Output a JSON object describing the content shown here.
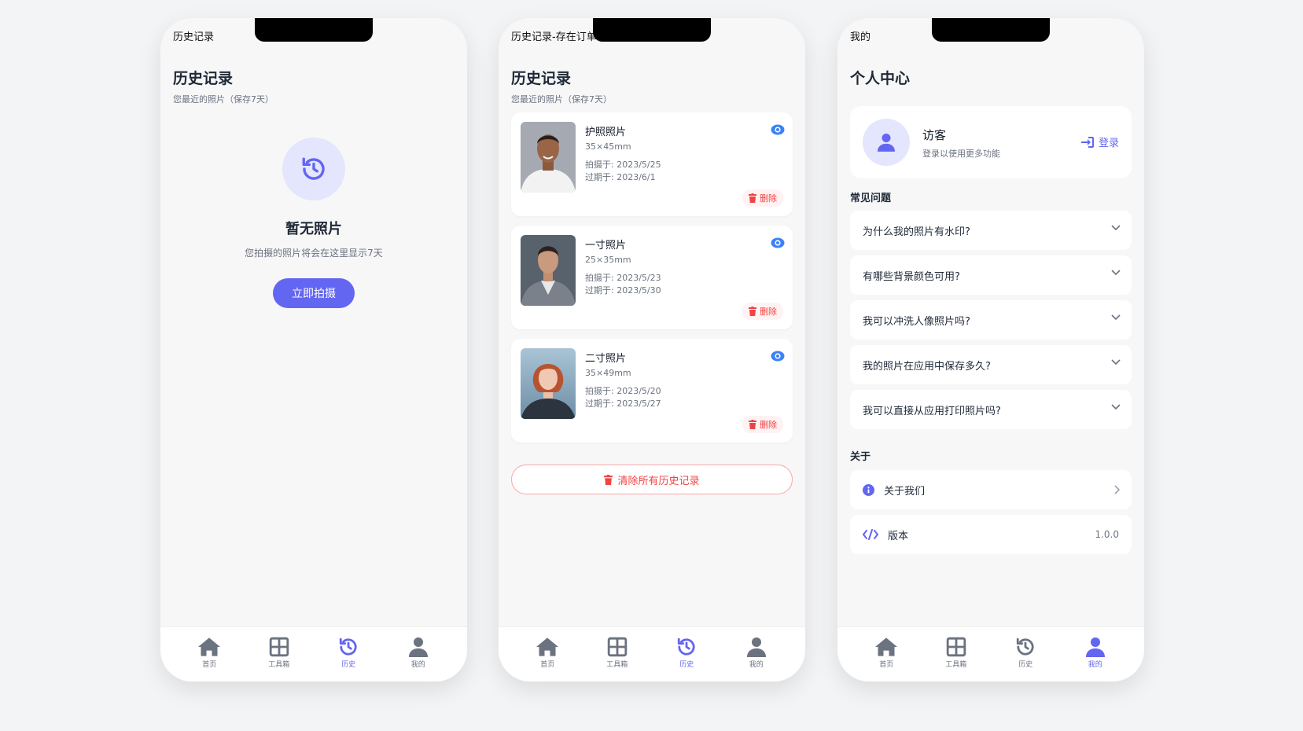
{
  "colors": {
    "accent": "#6366f1",
    "danger": "#ef4444",
    "icon_gray": "#6b7280"
  },
  "tabs": [
    "首页",
    "工具箱",
    "历史",
    "我的"
  ],
  "screen1": {
    "status_title": "历史记录",
    "title": "历史记录",
    "subtitle": "您最近的照片（保存7天）",
    "empty_title": "暂无照片",
    "empty_desc": "您拍摄的照片将会在这里显示7天",
    "action": "立即拍摄",
    "active_tab": "历史"
  },
  "screen2": {
    "status_title": "历史记录-存在订单",
    "title": "历史记录",
    "subtitle": "您最近的照片（保存7天）",
    "delete_label": "删除",
    "clear_label": "清除所有历史记录",
    "items": [
      {
        "name": "护照照片",
        "size": "35×45mm",
        "taken": "拍摄于: 2023/5/25",
        "expires": "过期于: 2023/6/1"
      },
      {
        "name": "一寸照片",
        "size": "25×35mm",
        "taken": "拍摄于: 2023/5/23",
        "expires": "过期于: 2023/5/30"
      },
      {
        "name": "二寸照片",
        "size": "35×49mm",
        "taken": "拍摄于: 2023/5/20",
        "expires": "过期于: 2023/5/27"
      }
    ],
    "active_tab": "历史"
  },
  "screen3": {
    "status_title": "我的",
    "title": "个人中心",
    "user_name": "访客",
    "user_sub": "登录以使用更多功能",
    "login_label": "登录",
    "faq_title": "常见问题",
    "faq": [
      "为什么我的照片有水印?",
      "有哪些背景颜色可用?",
      "我可以冲洗人像照片吗?",
      "我的照片在应用中保存多久?",
      "我可以直接从应用打印照片吗?"
    ],
    "about_title": "关于",
    "about_us": "关于我们",
    "version_label": "版本",
    "version_value": "1.0.0",
    "active_tab": "我的"
  }
}
